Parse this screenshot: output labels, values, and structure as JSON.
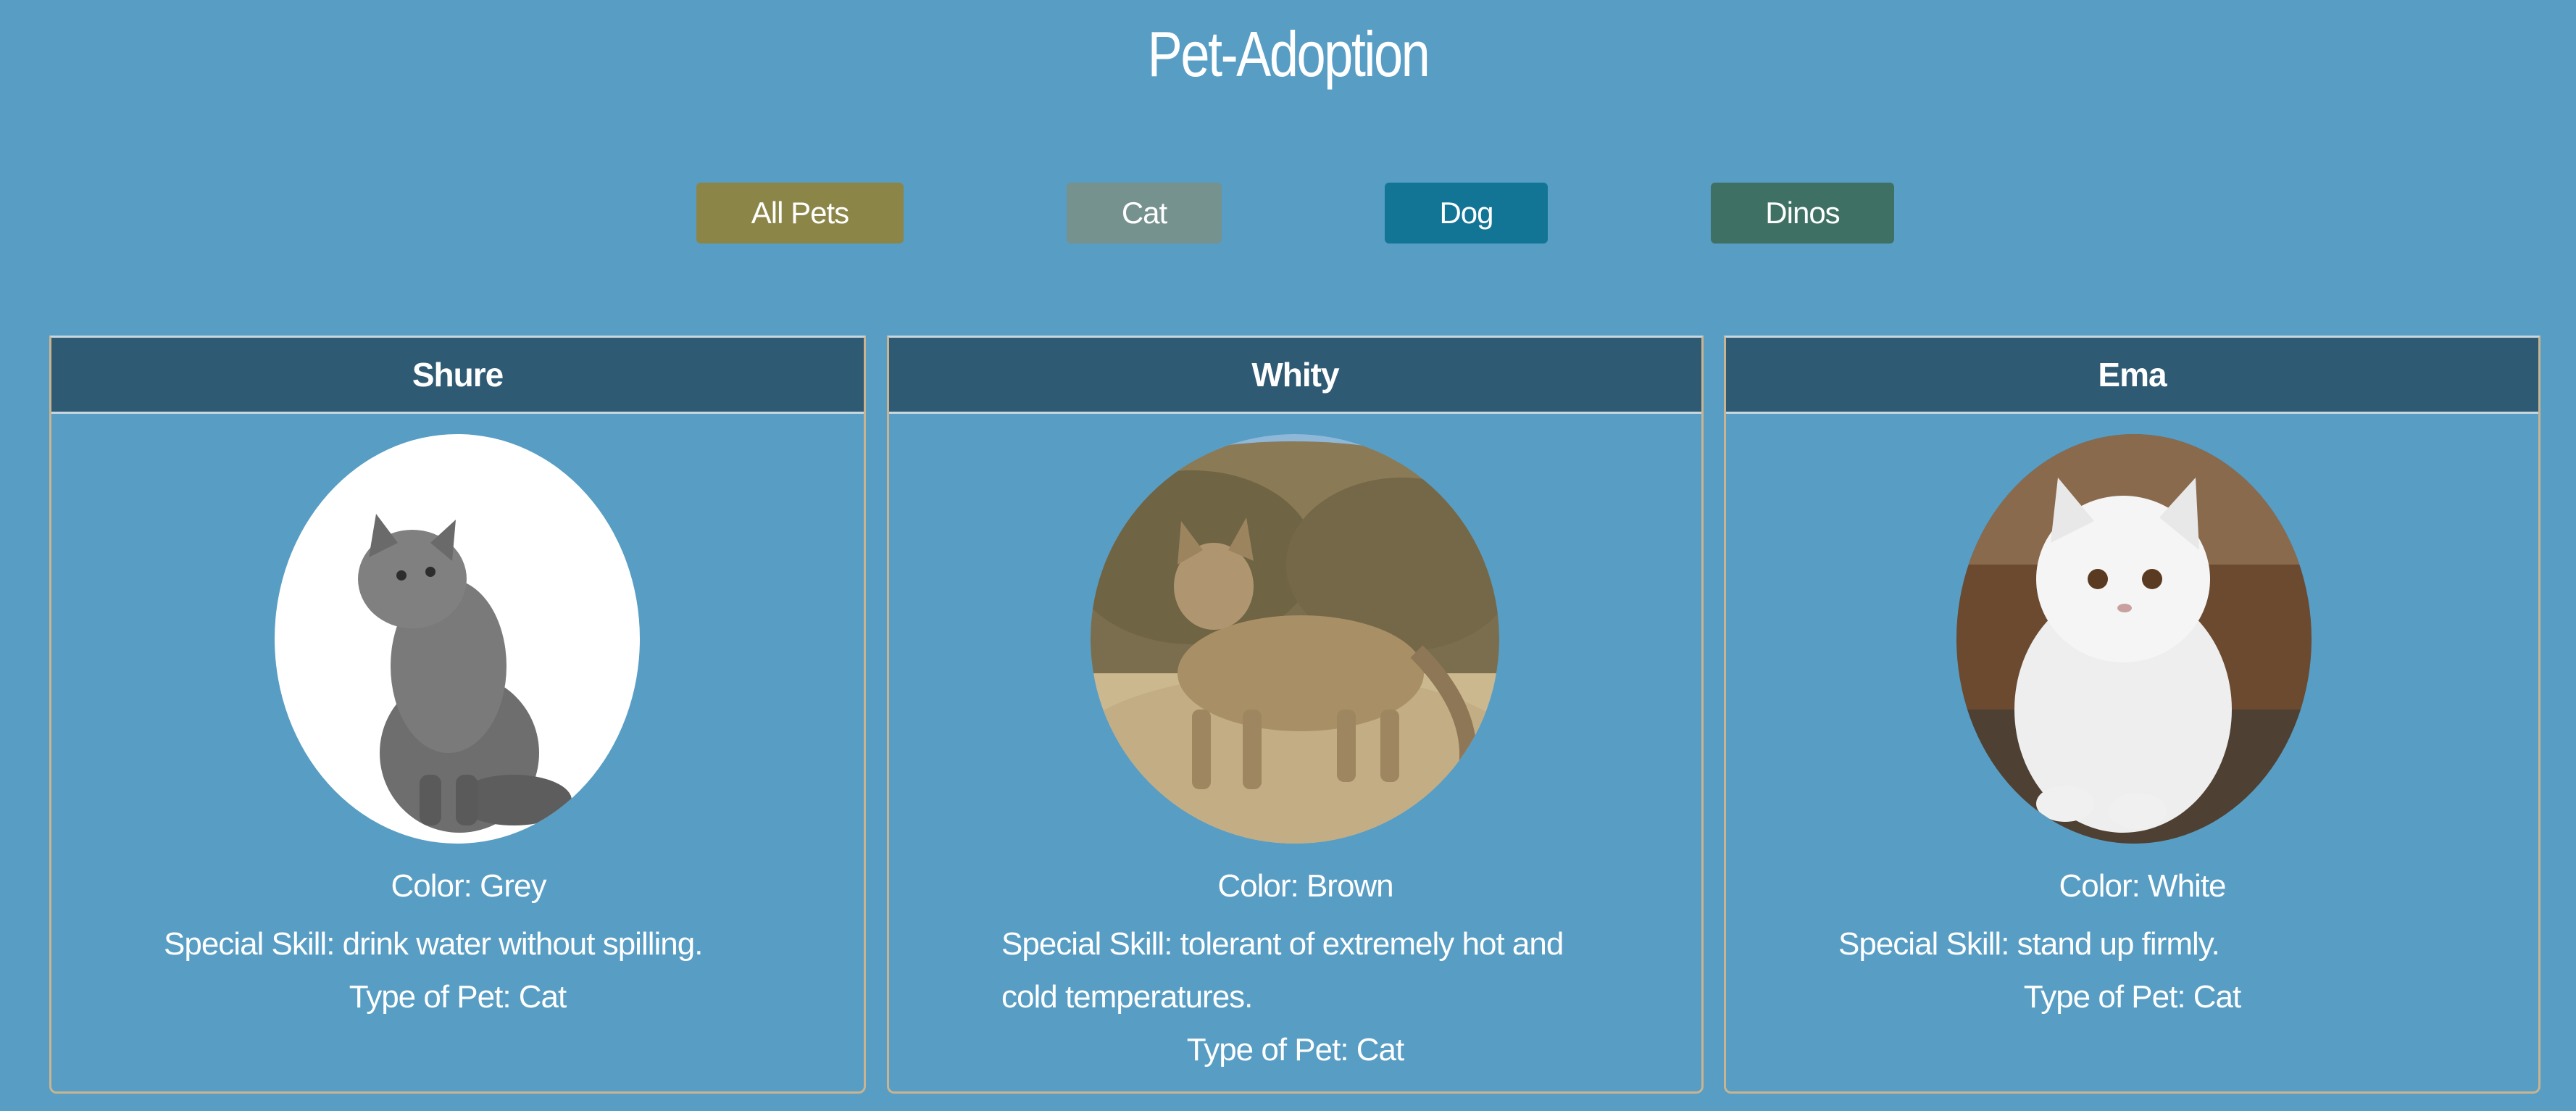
{
  "title": "Pet-Adoption",
  "filters": [
    {
      "label": "All Pets",
      "color": "#8c8548"
    },
    {
      "label": "Cat",
      "color": "#76928f"
    },
    {
      "label": "Dog",
      "color": "#137595"
    },
    {
      "label": "Dinos",
      "color": "#3e7164"
    }
  ],
  "pets": [
    {
      "name": "Shure",
      "image": "grey-cat-photo",
      "color": "Color: Grey",
      "skill": "Special Skill: drink water without spilling.",
      "type": "Type of Pet: Cat"
    },
    {
      "name": "Whity",
      "image": "sand-cat-photo",
      "color": "Color: Brown",
      "skill": "Special Skill: tolerant of extremely hot and cold temperatures.",
      "type": "Type of Pet: Cat"
    },
    {
      "name": "Ema",
      "image": "white-persian-cat-photo",
      "color": "Color: White",
      "skill": "Special Skill: stand up firmly.",
      "type": "Type of Pet: Cat"
    }
  ],
  "colors": {
    "background": "#579dc4",
    "card_header": "#2f5a73",
    "card_border": "#c9b48f"
  }
}
